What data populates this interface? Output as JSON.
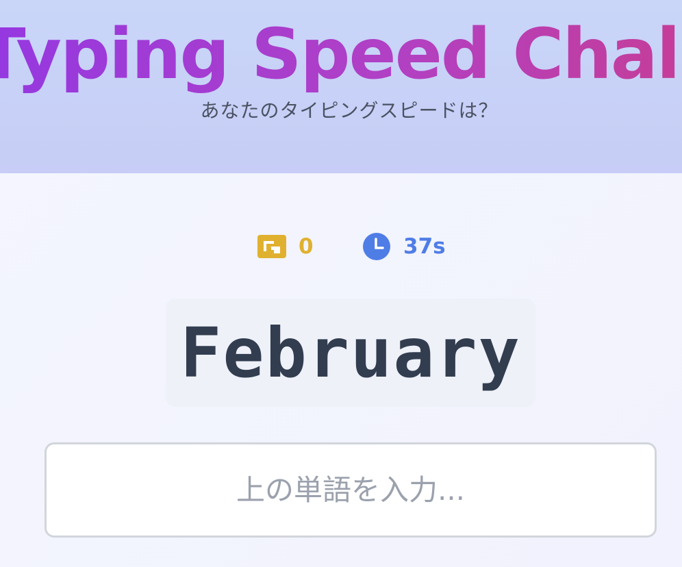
{
  "header": {
    "title": "Typing Speed Challenge",
    "subtitle": "あなたのタイピングスピードは？"
  },
  "stats": {
    "score": {
      "icon": "trophy-icon",
      "value": "0",
      "color": "#e0b12f"
    },
    "timer": {
      "icon": "clock-icon",
      "value": "37s",
      "color": "#4f7de6"
    }
  },
  "word": {
    "current": "February"
  },
  "input": {
    "value": "",
    "placeholder": "上の単語を入力..."
  },
  "colors": {
    "title_gradient": [
      "#9438e2",
      "#b140c4",
      "#d33b7a"
    ],
    "header_bg": "#c9d6f8",
    "word_text": "#323d50"
  }
}
